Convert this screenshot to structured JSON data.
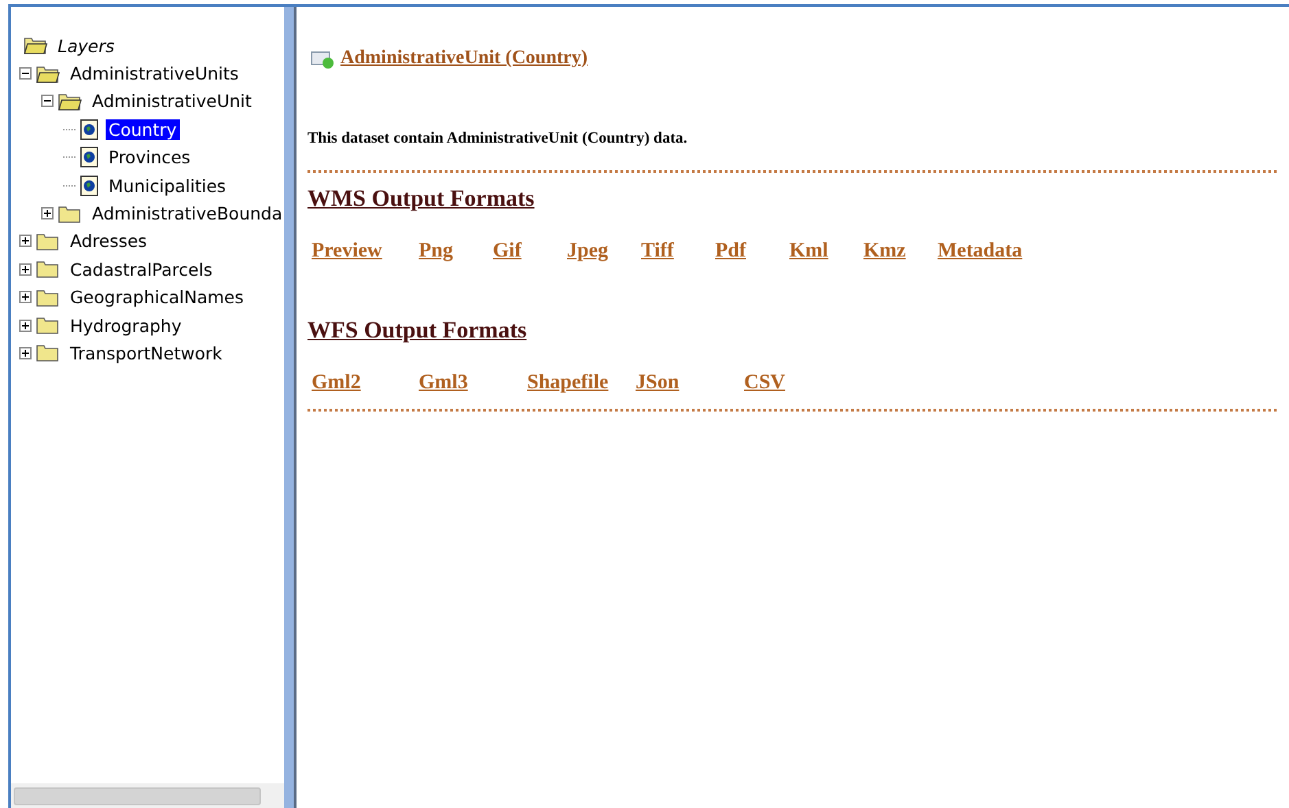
{
  "tree": {
    "label": "Layers",
    "expanded": true,
    "children": [
      {
        "kind": "folder",
        "label": "AdministrativeUnits",
        "expanded": true,
        "selected": false,
        "children": [
          {
            "kind": "folder",
            "label": "AdministrativeUnit",
            "expanded": true,
            "selected": false,
            "children": [
              {
                "kind": "layer",
                "label": "Country",
                "selected": true
              },
              {
                "kind": "layer",
                "label": "Provinces",
                "selected": false
              },
              {
                "kind": "layer",
                "label": "Municipalities",
                "selected": false
              }
            ]
          },
          {
            "kind": "folder",
            "label": "AdministrativeBounda",
            "expanded": false,
            "selected": false
          }
        ]
      },
      {
        "kind": "folder",
        "label": "Adresses",
        "expanded": false,
        "selected": false
      },
      {
        "kind": "folder",
        "label": "CadastralParcels",
        "expanded": false,
        "selected": false
      },
      {
        "kind": "folder",
        "label": "GeographicalNames",
        "expanded": false,
        "selected": false
      },
      {
        "kind": "folder",
        "label": "Hydrography",
        "expanded": false,
        "selected": false
      },
      {
        "kind": "folder",
        "label": "TransportNetwork",
        "expanded": false,
        "selected": false
      }
    ]
  },
  "content": {
    "title": "AdministrativeUnit (Country)",
    "description": "This dataset contain AdministrativeUnit (Country) data.",
    "sections": [
      {
        "heading": "WMS Output Formats",
        "links": [
          "Preview",
          "Png",
          "Gif",
          "Jpeg",
          "Tiff",
          "Pdf",
          "Kml",
          "Kmz",
          "Metadata"
        ]
      },
      {
        "heading": "WFS Output Formats",
        "links": [
          "Gml2",
          "Gml3",
          "Shapefile",
          "JSon",
          "CSV"
        ]
      }
    ]
  }
}
